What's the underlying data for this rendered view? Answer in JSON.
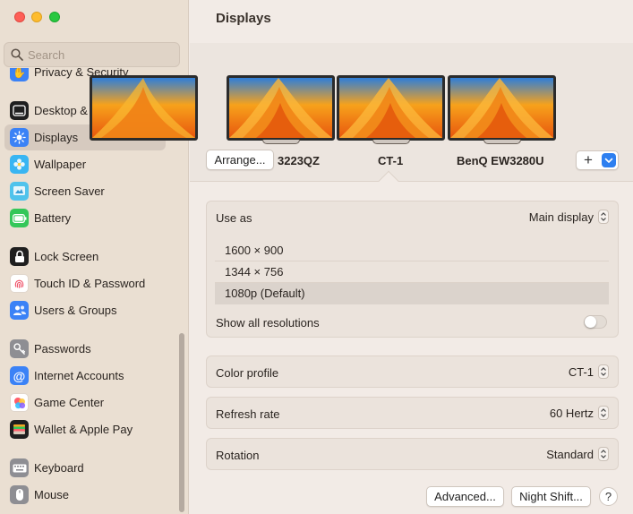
{
  "window": {
    "traffic_lights": [
      "close",
      "minimize",
      "zoom"
    ]
  },
  "search": {
    "placeholder": "Search",
    "value": ""
  },
  "sidebar": {
    "items": [
      {
        "label": "Privacy & Security",
        "icon": "hand-icon",
        "color": "#3b82f6"
      },
      {
        "label": "Desktop & Dock",
        "icon": "dock-icon",
        "color": "#1f1f1f"
      },
      {
        "label": "Displays",
        "icon": "sun-icon",
        "color": "#3b82f6",
        "selected": true
      },
      {
        "label": "Wallpaper",
        "icon": "flower-icon",
        "color": "#39b5f2"
      },
      {
        "label": "Screen Saver",
        "icon": "screen-saver-icon",
        "color": "#4fc3ec"
      },
      {
        "label": "Battery",
        "icon": "battery-icon",
        "color": "#34c759"
      },
      {
        "label": "Lock Screen",
        "icon": "lock-icon",
        "color": "#1f1f1f"
      },
      {
        "label": "Touch ID & Password",
        "icon": "fingerprint-icon",
        "color": "#ffffff"
      },
      {
        "label": "Users & Groups",
        "icon": "users-icon",
        "color": "#3b82f6"
      },
      {
        "label": "Passwords",
        "icon": "key-icon",
        "color": "#8e8e93"
      },
      {
        "label": "Internet Accounts",
        "icon": "at-icon",
        "color": "#3b82f6"
      },
      {
        "label": "Game Center",
        "icon": "game-center-icon",
        "color": "#ffffff"
      },
      {
        "label": "Wallet & Apple Pay",
        "icon": "wallet-icon",
        "color": "#1f1f1f"
      },
      {
        "label": "Keyboard",
        "icon": "keyboard-icon",
        "color": "#8e8e93"
      },
      {
        "label": "Mouse",
        "icon": "mouse-icon",
        "color": "#8e8e93"
      }
    ]
  },
  "main": {
    "title": "Displays",
    "arrange_button": "Arrange...",
    "displays": [
      {
        "label": "3223QZ"
      },
      {
        "label": "CT-1",
        "selected": true
      },
      {
        "label": "BenQ EW3280U"
      }
    ],
    "add_button": "+",
    "use_as": {
      "label": "Use as",
      "value": "Main display"
    },
    "resolutions": [
      "1600 × 900",
      "1344 × 756",
      "1080p (Default)"
    ],
    "selected_resolution": "1080p (Default)",
    "show_all_resolutions": {
      "label": "Show all resolutions",
      "on": false
    },
    "color_profile": {
      "label": "Color profile",
      "value": "CT-1"
    },
    "refresh_rate": {
      "label": "Refresh rate",
      "value": "60 Hertz"
    },
    "rotation": {
      "label": "Rotation",
      "value": "Standard"
    },
    "advanced_button": "Advanced...",
    "night_shift_button": "Night Shift...",
    "help_button": "?"
  },
  "colors": {
    "accent": "#2d7ff0",
    "sidebar_bg": "#eadfd2",
    "selection": "#d6cabf"
  }
}
